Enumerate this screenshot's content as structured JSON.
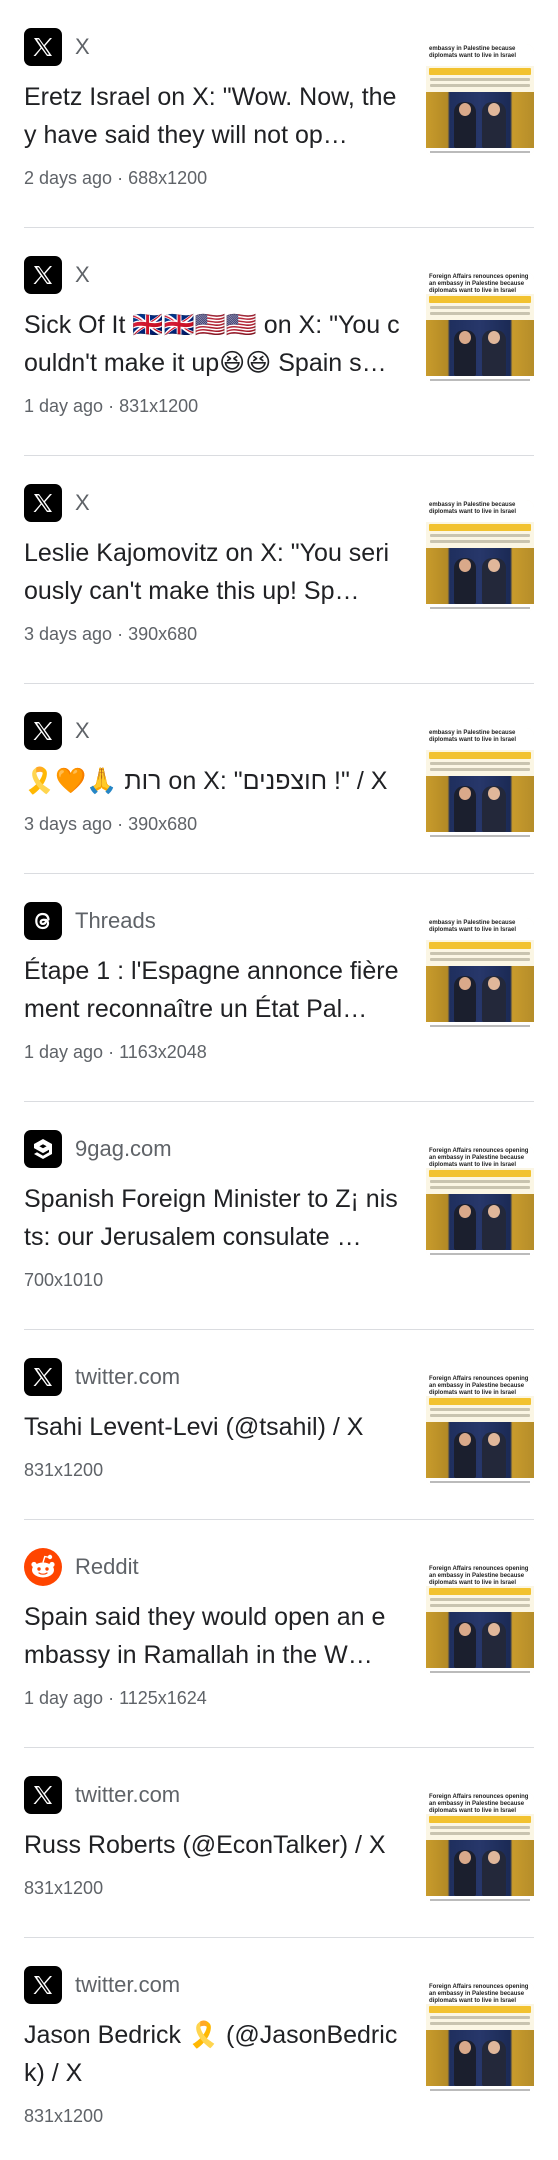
{
  "results": [
    {
      "source": "X",
      "favicon": "x-logo-icon",
      "title": "Eretz Israel on X: \"Wow. Now, they have said they will not op…",
      "meta": "2 days ago · 688x1200",
      "thumb_header": "embassy in Palestine because diplomats want to live in Israel"
    },
    {
      "source": "X",
      "favicon": "x-logo-icon",
      "title": "Sick Of It 🇬🇧🇬🇧🇺🇸🇺🇸 on X: \"You couldn't make it up😆😆 Spain s…",
      "meta": "1 day ago · 831x1200",
      "thumb_header": "Foreign Affairs renounces opening an embassy in Palestine because diplomats want to live in Israel"
    },
    {
      "source": "X",
      "favicon": "x-logo-icon",
      "title": "Leslie Kajomovitz on X: \"You seriously can't make this up! Sp…",
      "meta": "3 days ago · 390x680",
      "thumb_header": "embassy in Palestine because diplomats want to live in Israel"
    },
    {
      "source": "X",
      "favicon": "x-logo-icon",
      "title": "🎗️🧡🙏 רות on X: \"חוצפנים !\" / X",
      "meta": "3 days ago · 390x680",
      "thumb_header": "embassy in Palestine because diplomats want to live in Israel"
    },
    {
      "source": "Threads",
      "favicon": "threads-logo-icon",
      "title": "Étape 1 : l'Espagne annonce fièrement reconnaître un État Pal…",
      "meta": "1 day ago · 1163x2048",
      "thumb_header": "embassy in Palestine because diplomats want to live in Israel"
    },
    {
      "source": "9gag.com",
      "favicon": "9gag-logo-icon",
      "title": "Spanish Foreign Minister to Z¡ nists: our Jerusalem consulate …",
      "meta": "700x1010",
      "thumb_header": "Foreign Affairs renounces opening an embassy in Palestine because diplomats want to live in Israel"
    },
    {
      "source": "twitter.com",
      "favicon": "x-logo-icon",
      "title": "Tsahi Levent-Levi (@tsahil) / X",
      "meta": "831x1200",
      "thumb_header": "Foreign Affairs renounces opening an embassy in Palestine because diplomats want to live in Israel"
    },
    {
      "source": "Reddit",
      "favicon": "reddit-logo-icon",
      "title": "Spain said they would open an embassy in Ramallah in the W…",
      "meta": "1 day ago · 1125x1624",
      "thumb_header": "Foreign Affairs renounces opening an embassy in Palestine because diplomats want to live in Israel"
    },
    {
      "source": "twitter.com",
      "favicon": "x-logo-icon",
      "title": "Russ Roberts (@EconTalker) / X",
      "meta": "831x1200",
      "thumb_header": "Foreign Affairs renounces opening an embassy in Palestine because diplomats want to live in Israel"
    },
    {
      "source": "twitter.com",
      "favicon": "x-logo-icon",
      "title": "Jason Bedrick 🎗️ (@JasonBedrick) / X",
      "meta": "831x1200",
      "thumb_header": "Foreign Affairs renounces opening an embassy in Palestine because diplomats want to live in Israel"
    }
  ],
  "colors": {
    "text_primary": "#202124",
    "text_secondary": "#5f6368",
    "divider": "#dadce0",
    "reddit_orange": "#ff4500"
  }
}
